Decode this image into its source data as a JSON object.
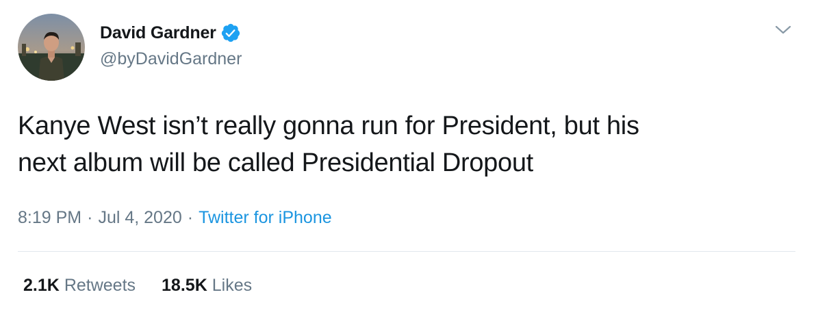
{
  "user": {
    "display_name": "David Gardner",
    "handle": "@byDavidGardner",
    "verified": true,
    "avatar": "profile-photo"
  },
  "tweet": {
    "text_line1": "Kanye West isn’t really gonna run for President, but his",
    "text_line2": "next album will be called Presidential Dropout"
  },
  "meta": {
    "time": "8:19 PM",
    "separator1": "·",
    "date": "Jul 4, 2020",
    "separator2": "·",
    "source": "Twitter for iPhone"
  },
  "stats": {
    "retweets_count": "2.1K",
    "retweets_label": "Retweets",
    "likes_count": "18.5K",
    "likes_label": "Likes"
  },
  "icons": {
    "verified": "verified-badge-icon",
    "menu": "chevron-down-icon"
  },
  "colors": {
    "primary_text": "#14171a",
    "secondary_text": "#657786",
    "link": "#1b95e0",
    "verified": "#1da1f2",
    "divider": "#e1e8ed"
  }
}
